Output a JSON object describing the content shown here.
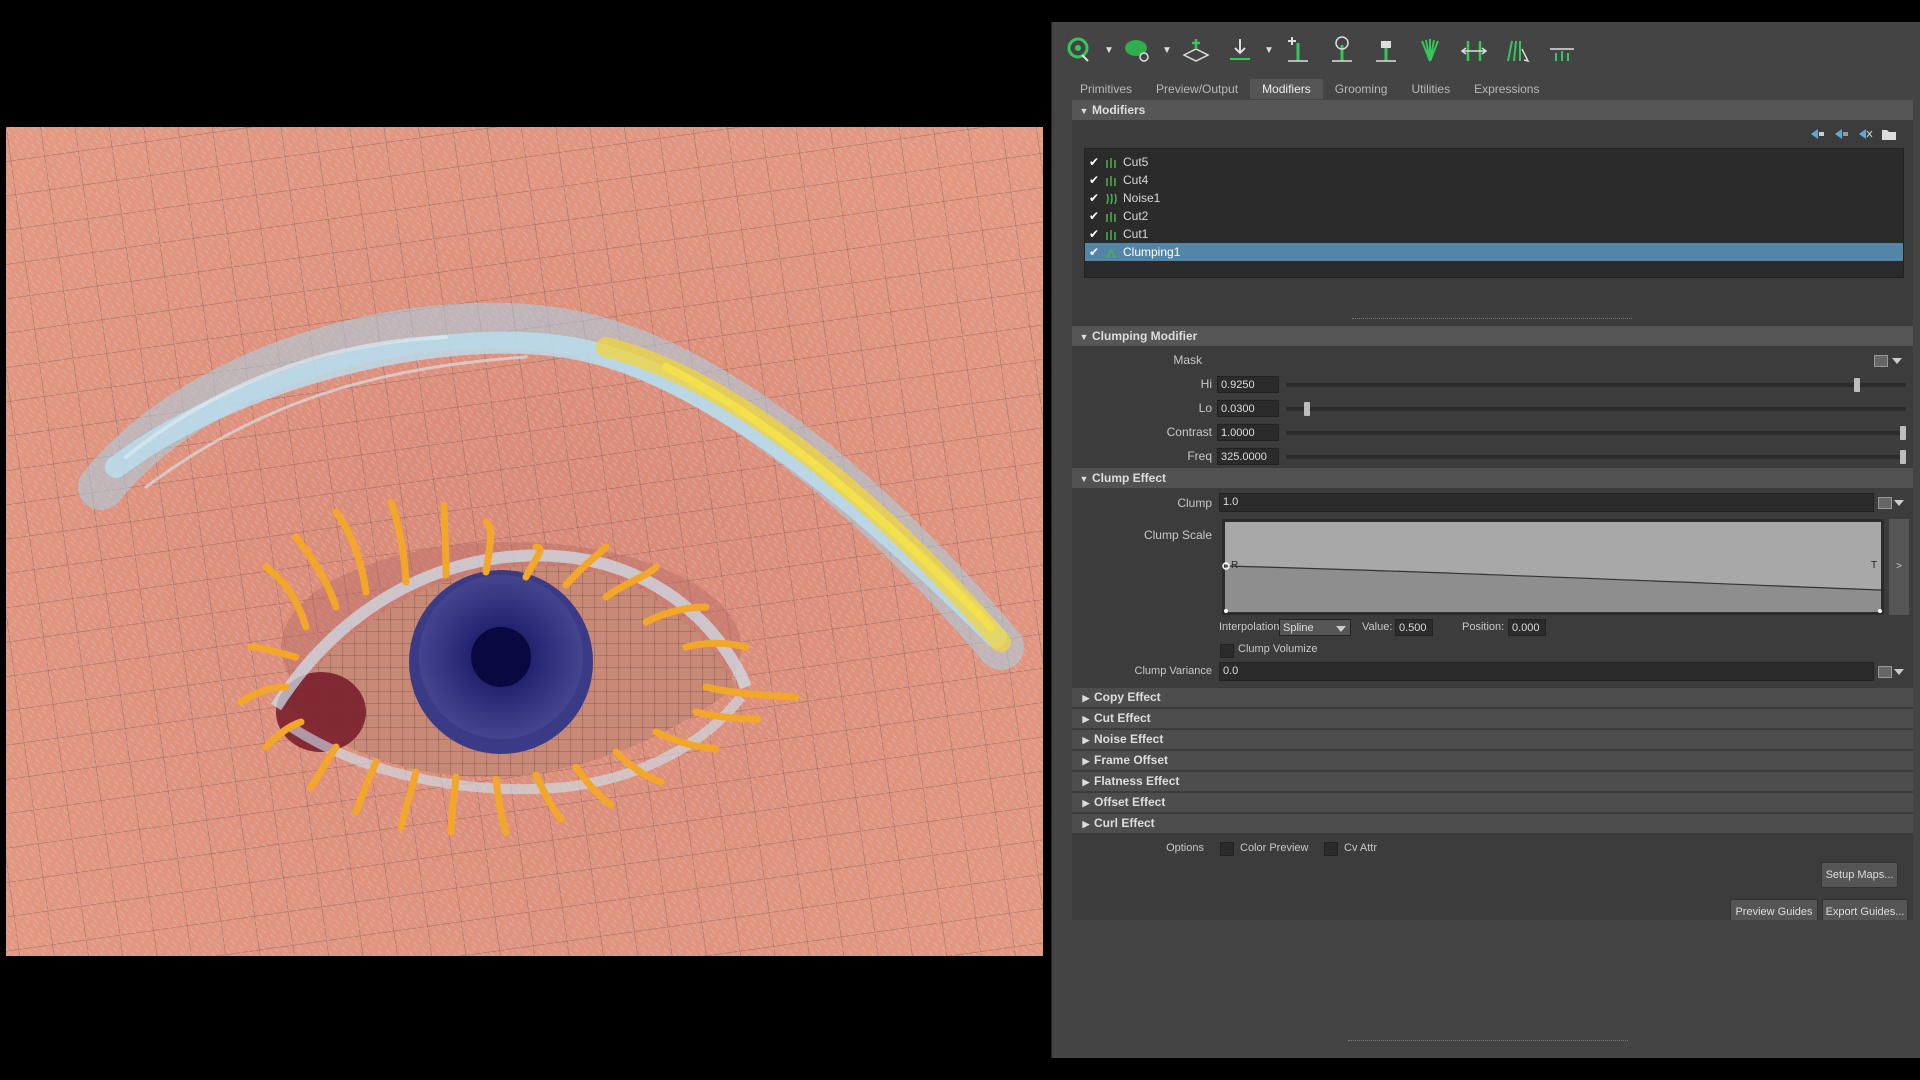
{
  "toolbar": {
    "icons": [
      "sphere-select-icon",
      "sphere-remove-icon",
      "grid-plant-icon",
      "comb-down-icon",
      "add-guide-icon",
      "lasso-guide-icon",
      "lock-guide-icon",
      "hair-spread-icon",
      "measure-icon",
      "brush-hair-icon",
      "cut-hair-icon"
    ]
  },
  "tabs": [
    "Primitives",
    "Preview/Output",
    "Modifiers",
    "Grooming",
    "Utilities",
    "Expressions"
  ],
  "active_tab": "Modifiers",
  "modifiers": {
    "header": "Modifiers",
    "items": [
      {
        "label": "Cut5",
        "checked": true,
        "selected": false
      },
      {
        "label": "Cut4",
        "checked": true,
        "selected": false
      },
      {
        "label": "Noise1",
        "checked": true,
        "selected": false
      },
      {
        "label": "Cut2",
        "checked": true,
        "selected": false
      },
      {
        "label": "Cut1",
        "checked": true,
        "selected": false
      },
      {
        "label": "Clumping1",
        "checked": true,
        "selected": true
      }
    ]
  },
  "clumping": {
    "header": "Clumping Modifier",
    "mask_label": "Mask",
    "hi_label": "Hi",
    "hi_value": "0.9250",
    "hi_fraction": 0.925,
    "lo_label": "Lo",
    "lo_value": "0.0300",
    "lo_fraction": 0.03,
    "contrast_label": "Contrast",
    "contrast_value": "1.0000",
    "contrast_fraction": 1.0,
    "freq_label": "Freq",
    "freq_value": "325.0000",
    "freq_fraction": 1.0
  },
  "clump_effect": {
    "header": "Clump Effect",
    "clump_label": "Clump",
    "clump_value": "1.0",
    "clump_scale_label": "Clump Scale",
    "curve_start_marker": "R",
    "curve_end_marker": "T",
    "interp_label": "Interpolation:",
    "interp_value": "Spline",
    "value_label": "Value:",
    "value_value": "0.500",
    "position_label": "Position:",
    "position_value": "0.000",
    "volumize_label": "Clump Volumize",
    "variance_label": "Clump Variance",
    "variance_value": "0.0",
    "expand_arrow": ">"
  },
  "collapsed_sections": [
    "Copy Effect",
    "Cut Effect",
    "Noise Effect",
    "Frame Offset",
    "Flatness Effect",
    "Offset Effect",
    "Curl Effect"
  ],
  "options": {
    "label": "Options",
    "color_preview": "Color Preview",
    "cv_attr": "Cv Attr"
  },
  "buttons": {
    "setup_maps": "Setup Maps...",
    "preview_guides": "Preview Guides",
    "export_guides": "Export Guides..."
  },
  "colors": {
    "selection": "#5285a6",
    "panel": "#444444",
    "lash": "#f2a72a",
    "brow": "#a8d2e6",
    "skin": "#e0907a",
    "iris": "#2b2a78"
  }
}
